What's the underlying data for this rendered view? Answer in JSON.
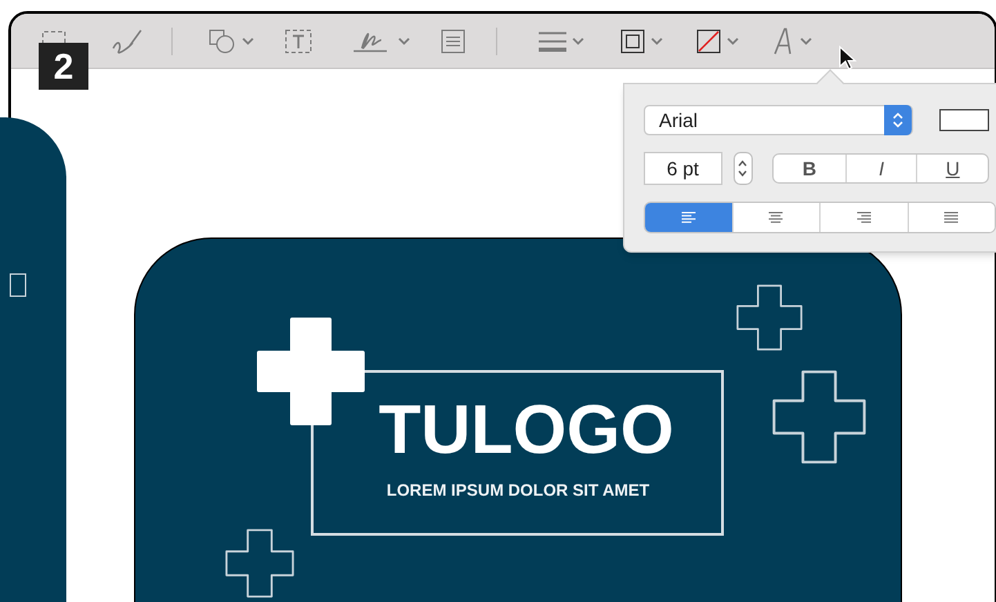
{
  "step_badge": "2",
  "font_popover": {
    "font": "Arial",
    "size": "6 pt",
    "styles": [
      {
        "kind": "bold",
        "label": "B",
        "selected": false
      },
      {
        "kind": "italic",
        "label": "I",
        "selected": false
      },
      {
        "kind": "underline",
        "label": "U",
        "selected": false
      }
    ],
    "alignments": [
      {
        "kind": "left",
        "selected": true
      },
      {
        "kind": "center",
        "selected": false
      },
      {
        "kind": "right",
        "selected": false
      },
      {
        "kind": "justify",
        "selected": false
      }
    ]
  },
  "canvas": {
    "logo_title": "TULOGO",
    "logo_tagline": "LOREM IPSUM DOLOR SIT AMET"
  }
}
